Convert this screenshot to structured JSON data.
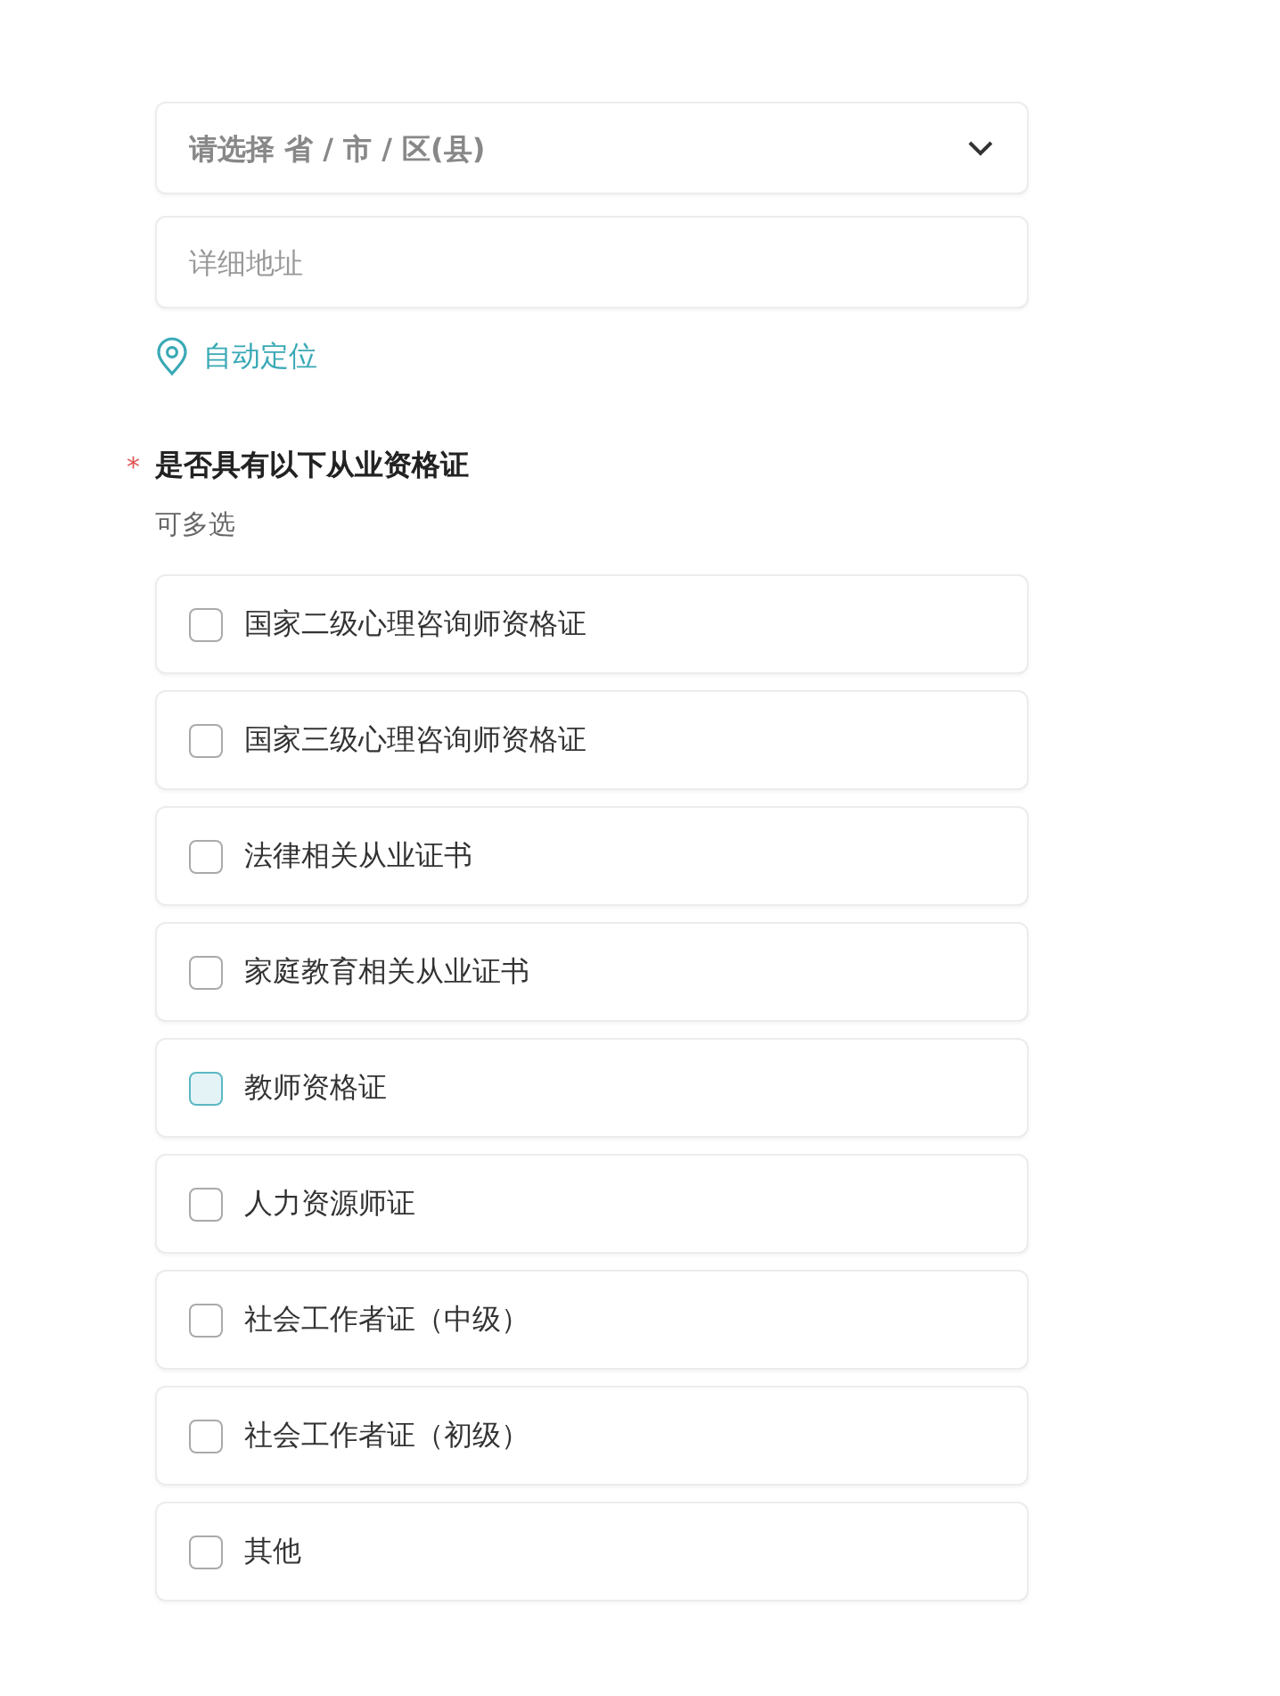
{
  "region_select": {
    "placeholder": "请选择 省 / 市 / 区(县)"
  },
  "address_field": {
    "placeholder": "详细地址"
  },
  "auto_locate": {
    "label": "自动定位"
  },
  "question": {
    "required_mark": "*",
    "title": "是否具有以下从业资格证",
    "hint": "可多选"
  },
  "options": [
    {
      "label": "国家二级心理咨询师资格证",
      "checked": false,
      "focused": false
    },
    {
      "label": "国家三级心理咨询师资格证",
      "checked": false,
      "focused": false
    },
    {
      "label": "法律相关从业证书",
      "checked": false,
      "focused": false
    },
    {
      "label": "家庭教育相关从业证书",
      "checked": false,
      "focused": false
    },
    {
      "label": "教师资格证",
      "checked": false,
      "focused": true
    },
    {
      "label": "人力资源师证",
      "checked": false,
      "focused": false
    },
    {
      "label": "社会工作者证（中级）",
      "checked": false,
      "focused": false
    },
    {
      "label": "社会工作者证（初级）",
      "checked": false,
      "focused": false
    },
    {
      "label": "其他",
      "checked": false,
      "focused": false
    }
  ]
}
